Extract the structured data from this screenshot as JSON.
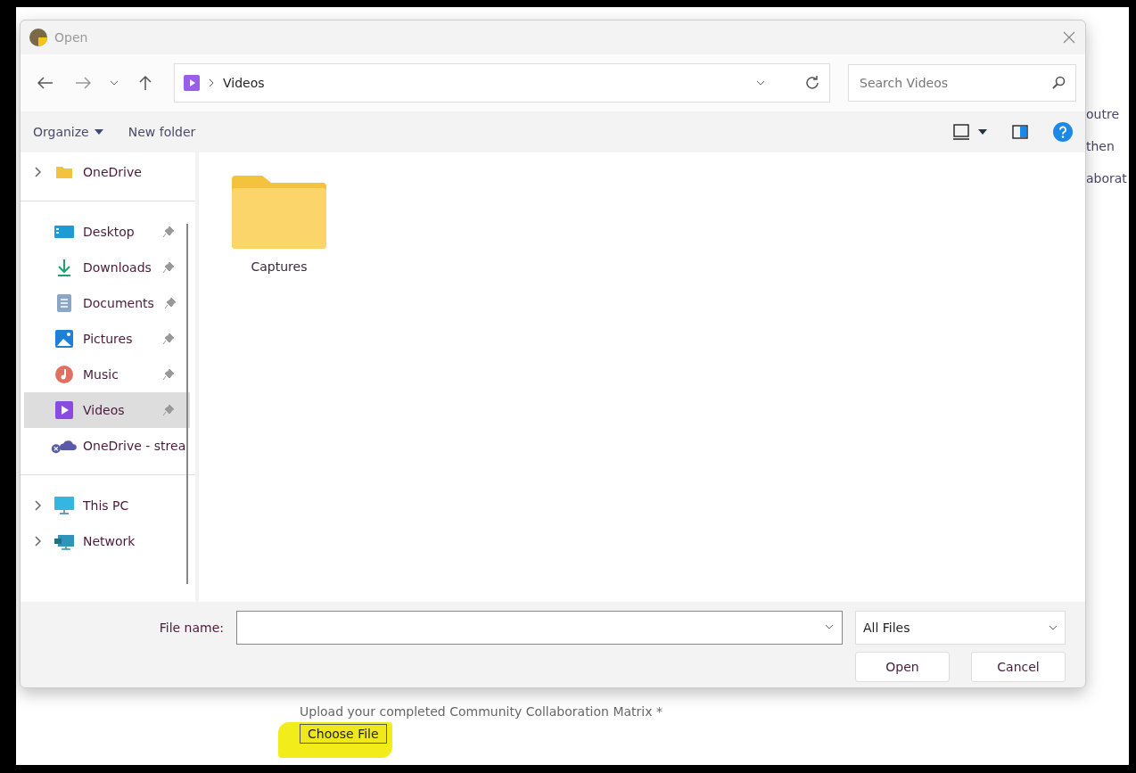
{
  "window": {
    "title": "Open"
  },
  "address": {
    "path": "Videos"
  },
  "search": {
    "placeholder": "Search Videos"
  },
  "toolbar": {
    "organize": "Organize",
    "new_folder": "New folder"
  },
  "sidebar": {
    "sections": [
      {
        "items": [
          {
            "label": "OneDrive",
            "kind": "folder",
            "pinned": false,
            "expandable": true,
            "selected": false
          }
        ]
      },
      {
        "items": [
          {
            "label": "Desktop",
            "kind": "desktop",
            "pinned": true,
            "expandable": false,
            "selected": false
          },
          {
            "label": "Downloads",
            "kind": "download",
            "pinned": true,
            "expandable": false,
            "selected": false
          },
          {
            "label": "Documents",
            "kind": "document",
            "pinned": true,
            "expandable": false,
            "selected": false
          },
          {
            "label": "Pictures",
            "kind": "pictures",
            "pinned": true,
            "expandable": false,
            "selected": false
          },
          {
            "label": "Music",
            "kind": "music",
            "pinned": true,
            "expandable": false,
            "selected": false
          },
          {
            "label": "Videos",
            "kind": "videos",
            "pinned": true,
            "expandable": false,
            "selected": true
          },
          {
            "label": "OneDrive - strea",
            "kind": "cloud",
            "pinned": false,
            "expandable": false,
            "selected": false
          }
        ]
      },
      {
        "items": [
          {
            "label": "This PC",
            "kind": "pc",
            "pinned": false,
            "expandable": true,
            "selected": false
          },
          {
            "label": "Network",
            "kind": "network",
            "pinned": false,
            "expandable": true,
            "selected": false
          }
        ]
      }
    ]
  },
  "files": [
    {
      "name": "Captures",
      "kind": "folder"
    }
  ],
  "file_name": {
    "label": "File name:"
  },
  "file_type": {
    "value": "All Files"
  },
  "buttons": [
    "Open",
    "Cancel"
  ],
  "background": {
    "fragments": [
      "outre",
      "then",
      "aborat"
    ],
    "upload_label": "Upload your completed Community Collaboration Matrix *",
    "choose_button": "Choose File",
    "highlighted": true
  }
}
